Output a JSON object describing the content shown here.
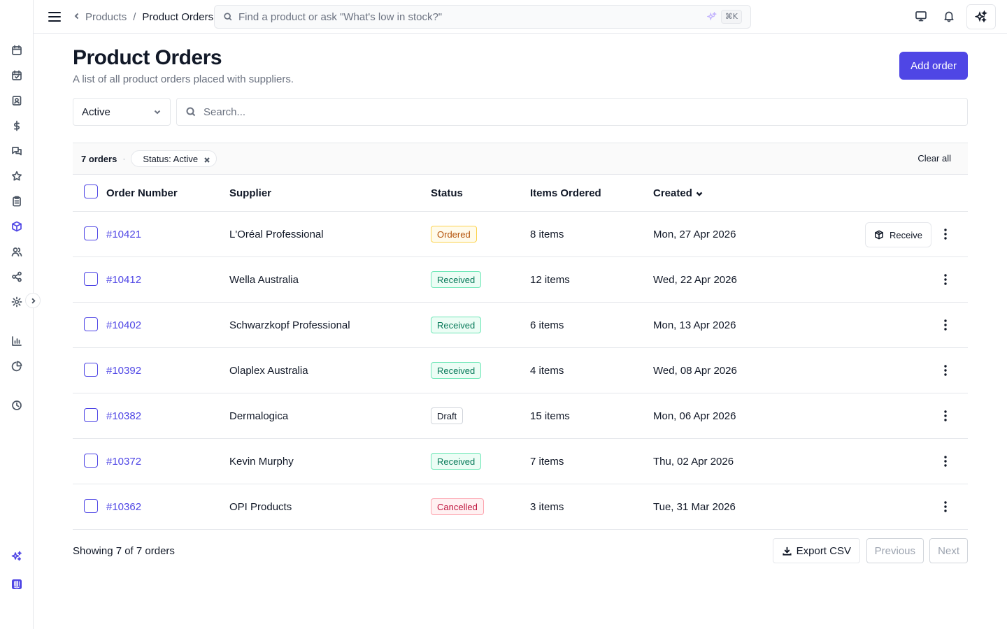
{
  "topbar": {
    "breadcrumb_parent": "Products",
    "breadcrumb_separator": "/",
    "breadcrumb_current": "Product Orders",
    "search_placeholder": "Find a product or ask \"What's low in stock?\"",
    "shortcut": "⌘K"
  },
  "page": {
    "title": "Product Orders",
    "subtitle": "A list of all product orders placed with suppliers.",
    "add_button": "Add order"
  },
  "filters": {
    "status_selected": "Active",
    "search_placeholder": "Search...",
    "count_label": "7 orders",
    "chip_label": "Status: Active",
    "clear_all": "Clear all"
  },
  "table": {
    "columns": {
      "order_number": "Order Number",
      "supplier": "Supplier",
      "status": "Status",
      "items_ordered": "Items Ordered",
      "created": "Created"
    },
    "receive_label": "Receive",
    "rows": [
      {
        "order": "#10421",
        "supplier": "L'Oréal Professional",
        "status": "Ordered",
        "items": "8 items",
        "created": "Mon, 27 Apr 2026"
      },
      {
        "order": "#10412",
        "supplier": "Wella Australia",
        "status": "Received",
        "items": "12 items",
        "created": "Wed, 22 Apr 2026"
      },
      {
        "order": "#10402",
        "supplier": "Schwarzkopf Professional",
        "status": "Received",
        "items": "6 items",
        "created": "Mon, 13 Apr 2026"
      },
      {
        "order": "#10392",
        "supplier": "Olaplex Australia",
        "status": "Received",
        "items": "4 items",
        "created": "Wed, 08 Apr 2026"
      },
      {
        "order": "#10382",
        "supplier": "Dermalogica",
        "status": "Draft",
        "items": "15 items",
        "created": "Mon, 06 Apr 2026"
      },
      {
        "order": "#10372",
        "supplier": "Kevin Murphy",
        "status": "Received",
        "items": "7 items",
        "created": "Thu, 02 Apr 2026"
      },
      {
        "order": "#10362",
        "supplier": "OPI Products",
        "status": "Cancelled",
        "items": "3 items",
        "created": "Tue, 31 Mar 2026"
      }
    ]
  },
  "status_colors": {
    "Ordered": {
      "text": "#b45309",
      "bg": "#fffbeb",
      "border": "#fcd34d"
    },
    "Received": {
      "text": "#047857",
      "bg": "#ecfdf5",
      "border": "#6ee7b7"
    },
    "Draft": {
      "text": "#111827",
      "bg": "#ffffff",
      "border": "#d1d5db"
    },
    "Cancelled": {
      "text": "#be123c",
      "bg": "#fff1f2",
      "border": "#fda4af"
    }
  },
  "footer": {
    "showing": "Showing 7 of 7 orders",
    "export": "Export CSV",
    "previous": "Previous",
    "next": "Next"
  },
  "colors": {
    "accent": "#4f46e5"
  },
  "sidebar_icons": [
    "calendar-icon",
    "calendar-check-icon",
    "contact-icon",
    "dollar-icon",
    "messages-icon",
    "star-icon",
    "clipboard-icon",
    "box-icon",
    "users-icon",
    "share-icon",
    "gear-icon",
    "bar-chart-icon",
    "pie-chart-icon",
    "clock-icon",
    "sparkle-icon",
    "intercom-icon"
  ]
}
